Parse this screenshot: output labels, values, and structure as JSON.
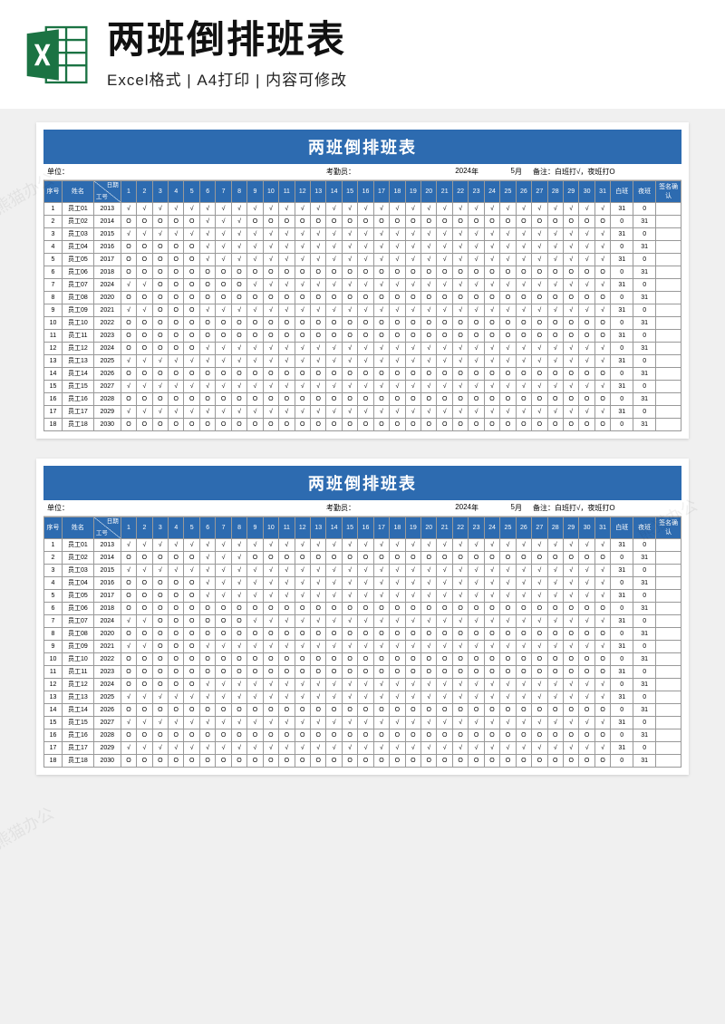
{
  "banner": {
    "title": "两班倒排班表",
    "subtitle": "Excel格式 | A4打印 | 内容可修改"
  },
  "watermark": "熊猫办公",
  "sheet": {
    "title": "两班倒排班表",
    "meta": {
      "unit_label": "单位：",
      "attendant_label": "考勤员：",
      "year": "2024",
      "year_label": "年",
      "month": "5",
      "month_label": "月",
      "note": "备注：白班打√，夜班打O"
    },
    "headers": {
      "index": "序号",
      "name": "姓名",
      "date": "日期",
      "emp_id": "工号",
      "day_shift": "白班",
      "night_shift": "夜班",
      "sign": "签名确认"
    },
    "days": [
      "1",
      "2",
      "3",
      "4",
      "5",
      "6",
      "7",
      "8",
      "9",
      "10",
      "11",
      "12",
      "13",
      "14",
      "15",
      "16",
      "17",
      "18",
      "19",
      "20",
      "21",
      "22",
      "23",
      "24",
      "25",
      "26",
      "27",
      "28",
      "29",
      "30",
      "31"
    ],
    "rows": [
      {
        "idx": "1",
        "name": "员工01",
        "eid": "2013",
        "p": [
          "√",
          "√",
          "√",
          "√",
          "√",
          "√",
          "√",
          "√",
          "√",
          "√",
          "√",
          "√",
          "√",
          "√",
          "√",
          "√",
          "√",
          "√",
          "√",
          "√",
          "√",
          "√",
          "√",
          "√",
          "√",
          "√",
          "√",
          "√",
          "√",
          "√",
          "√"
        ],
        "day": "31",
        "night": "0"
      },
      {
        "idx": "2",
        "name": "员工02",
        "eid": "2014",
        "p": [
          "O",
          "O",
          "O",
          "O",
          "O",
          "√",
          "√",
          "√",
          "O",
          "O",
          "O",
          "O",
          "O",
          "O",
          "O",
          "O",
          "O",
          "O",
          "O",
          "O",
          "O",
          "O",
          "O",
          "O",
          "O",
          "O",
          "O",
          "O",
          "O",
          "O",
          "O"
        ],
        "day": "0",
        "night": "31"
      },
      {
        "idx": "3",
        "name": "员工03",
        "eid": "2015",
        "p": [
          "√",
          "√",
          "√",
          "√",
          "√",
          "√",
          "√",
          "√",
          "√",
          "√",
          "√",
          "√",
          "√",
          "√",
          "√",
          "√",
          "√",
          "√",
          "√",
          "√",
          "√",
          "√",
          "√",
          "√",
          "√",
          "√",
          "√",
          "√",
          "√",
          "√",
          "√"
        ],
        "day": "31",
        "night": "0"
      },
      {
        "idx": "4",
        "name": "员工04",
        "eid": "2016",
        "p": [
          "O",
          "O",
          "O",
          "O",
          "O",
          "√",
          "√",
          "√",
          "√",
          "√",
          "√",
          "√",
          "√",
          "√",
          "√",
          "√",
          "√",
          "√",
          "√",
          "√",
          "√",
          "√",
          "√",
          "√",
          "√",
          "√",
          "√",
          "√",
          "√",
          "√",
          "√"
        ],
        "day": "0",
        "night": "31"
      },
      {
        "idx": "5",
        "name": "员工05",
        "eid": "2017",
        "p": [
          "O",
          "O",
          "O",
          "O",
          "O",
          "√",
          "√",
          "√",
          "√",
          "√",
          "√",
          "√",
          "√",
          "√",
          "√",
          "√",
          "√",
          "√",
          "√",
          "√",
          "√",
          "√",
          "√",
          "√",
          "√",
          "√",
          "√",
          "√",
          "√",
          "√",
          "√"
        ],
        "day": "31",
        "night": "0"
      },
      {
        "idx": "6",
        "name": "员工06",
        "eid": "2018",
        "p": [
          "O",
          "O",
          "O",
          "O",
          "O",
          "O",
          "O",
          "O",
          "O",
          "O",
          "O",
          "O",
          "O",
          "O",
          "O",
          "O",
          "O",
          "O",
          "O",
          "O",
          "O",
          "O",
          "O",
          "O",
          "O",
          "O",
          "O",
          "O",
          "O",
          "O",
          "O"
        ],
        "day": "0",
        "night": "31"
      },
      {
        "idx": "7",
        "name": "员工07",
        "eid": "2024",
        "p": [
          "√",
          "√",
          "O",
          "O",
          "O",
          "O",
          "O",
          "O",
          "√",
          "√",
          "√",
          "√",
          "√",
          "√",
          "√",
          "√",
          "√",
          "√",
          "√",
          "√",
          "√",
          "√",
          "√",
          "√",
          "√",
          "√",
          "√",
          "√",
          "√",
          "√",
          "√"
        ],
        "day": "31",
        "night": "0"
      },
      {
        "idx": "8",
        "name": "员工08",
        "eid": "2020",
        "p": [
          "O",
          "O",
          "O",
          "O",
          "O",
          "O",
          "O",
          "O",
          "O",
          "O",
          "O",
          "O",
          "O",
          "O",
          "O",
          "O",
          "O",
          "O",
          "O",
          "O",
          "O",
          "O",
          "O",
          "O",
          "O",
          "O",
          "O",
          "O",
          "O",
          "O",
          "O"
        ],
        "day": "0",
        "night": "31"
      },
      {
        "idx": "9",
        "name": "员工09",
        "eid": "2021",
        "p": [
          "√",
          "√",
          "O",
          "O",
          "O",
          "√",
          "√",
          "√",
          "√",
          "√",
          "√",
          "√",
          "√",
          "√",
          "√",
          "√",
          "√",
          "√",
          "√",
          "√",
          "√",
          "√",
          "√",
          "√",
          "√",
          "√",
          "√",
          "√",
          "√",
          "√",
          "√"
        ],
        "day": "31",
        "night": "0"
      },
      {
        "idx": "10",
        "name": "员工10",
        "eid": "2022",
        "p": [
          "O",
          "O",
          "O",
          "O",
          "O",
          "O",
          "O",
          "O",
          "O",
          "O",
          "O",
          "O",
          "O",
          "O",
          "O",
          "O",
          "O",
          "O",
          "O",
          "O",
          "O",
          "O",
          "O",
          "O",
          "O",
          "O",
          "O",
          "O",
          "O",
          "O",
          "O"
        ],
        "day": "0",
        "night": "31"
      },
      {
        "idx": "11",
        "name": "员工11",
        "eid": "2023",
        "p": [
          "O",
          "O",
          "O",
          "O",
          "O",
          "O",
          "O",
          "O",
          "O",
          "O",
          "O",
          "O",
          "O",
          "O",
          "O",
          "O",
          "O",
          "O",
          "O",
          "O",
          "O",
          "O",
          "O",
          "O",
          "O",
          "O",
          "O",
          "O",
          "O",
          "O",
          "O"
        ],
        "day": "31",
        "night": "0"
      },
      {
        "idx": "12",
        "name": "员工12",
        "eid": "2024",
        "p": [
          "O",
          "O",
          "O",
          "O",
          "O",
          "√",
          "√",
          "√",
          "√",
          "√",
          "√",
          "√",
          "√",
          "√",
          "√",
          "√",
          "√",
          "√",
          "√",
          "√",
          "√",
          "√",
          "√",
          "√",
          "√",
          "√",
          "√",
          "√",
          "√",
          "√",
          "√"
        ],
        "day": "0",
        "night": "31"
      },
      {
        "idx": "13",
        "name": "员工13",
        "eid": "2025",
        "p": [
          "√",
          "√",
          "√",
          "√",
          "√",
          "√",
          "√",
          "√",
          "√",
          "√",
          "√",
          "√",
          "√",
          "√",
          "√",
          "√",
          "√",
          "√",
          "√",
          "√",
          "√",
          "√",
          "√",
          "√",
          "√",
          "√",
          "√",
          "√",
          "√",
          "√",
          "√"
        ],
        "day": "31",
        "night": "0"
      },
      {
        "idx": "14",
        "name": "员工14",
        "eid": "2026",
        "p": [
          "O",
          "O",
          "O",
          "O",
          "O",
          "O",
          "O",
          "O",
          "O",
          "O",
          "O",
          "O",
          "O",
          "O",
          "O",
          "O",
          "O",
          "O",
          "O",
          "O",
          "O",
          "O",
          "O",
          "O",
          "O",
          "O",
          "O",
          "O",
          "O",
          "O",
          "O"
        ],
        "day": "0",
        "night": "31"
      },
      {
        "idx": "15",
        "name": "员工15",
        "eid": "2027",
        "p": [
          "√",
          "√",
          "√",
          "√",
          "√",
          "√",
          "√",
          "√",
          "√",
          "√",
          "√",
          "√",
          "√",
          "√",
          "√",
          "√",
          "√",
          "√",
          "√",
          "√",
          "√",
          "√",
          "√",
          "√",
          "√",
          "√",
          "√",
          "√",
          "√",
          "√",
          "√"
        ],
        "day": "31",
        "night": "0"
      },
      {
        "idx": "16",
        "name": "员工16",
        "eid": "2028",
        "p": [
          "O",
          "O",
          "O",
          "O",
          "O",
          "O",
          "O",
          "O",
          "O",
          "O",
          "O",
          "O",
          "O",
          "O",
          "O",
          "O",
          "O",
          "O",
          "O",
          "O",
          "O",
          "O",
          "O",
          "O",
          "O",
          "O",
          "O",
          "O",
          "O",
          "O",
          "O"
        ],
        "day": "0",
        "night": "31"
      },
      {
        "idx": "17",
        "name": "员工17",
        "eid": "2029",
        "p": [
          "√",
          "√",
          "√",
          "√",
          "√",
          "√",
          "√",
          "√",
          "√",
          "√",
          "√",
          "√",
          "√",
          "√",
          "√",
          "√",
          "√",
          "√",
          "√",
          "√",
          "√",
          "√",
          "√",
          "√",
          "√",
          "√",
          "√",
          "√",
          "√",
          "√",
          "√"
        ],
        "day": "31",
        "night": "0"
      },
      {
        "idx": "18",
        "name": "员工18",
        "eid": "2030",
        "p": [
          "O",
          "O",
          "O",
          "O",
          "O",
          "O",
          "O",
          "O",
          "O",
          "O",
          "O",
          "O",
          "O",
          "O",
          "O",
          "O",
          "O",
          "O",
          "O",
          "O",
          "O",
          "O",
          "O",
          "O",
          "O",
          "O",
          "O",
          "O",
          "O",
          "O",
          "O"
        ],
        "day": "0",
        "night": "31"
      }
    ]
  }
}
